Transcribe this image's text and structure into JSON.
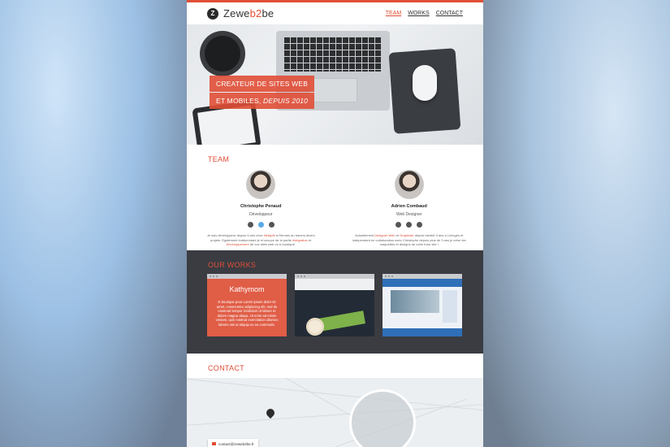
{
  "header": {
    "logo_mark": "Z",
    "logo_prefix": "Zewe",
    "logo_accent": "b2",
    "logo_suffix": "be",
    "nav": [
      "TEAM",
      "WORKS",
      "CONTACT"
    ],
    "active_nav": "TEAM"
  },
  "hero": {
    "line1": "CREATEUR DE SITES WEB",
    "line2_main": "ET MOBILES, ",
    "line2_italic": "DEPUIS 2010"
  },
  "team": {
    "title": "TEAM",
    "members": [
      {
        "name": "Christophe Penaud",
        "role": "Développeur",
        "desc_before": "Je suis développeur depuis 5 ans chez ",
        "desc_hl1": "Netapfe",
        "desc_mid": " à Rennes au travers divers projets. Egalement indépendant je m'occupe de la partie ",
        "desc_hl2": "Intégration",
        "desc_and": " et ",
        "desc_hl3": "Développement",
        "desc_after": " de vos sites web ou e-boutique."
      },
      {
        "name": "Adrien Combaud",
        "role": "Web Designer",
        "desc_before": "Actuellement ",
        "desc_hl1": "Designer Web",
        "desc_mid": " et ",
        "desc_hl2": "Graphiste",
        "desc_after": " depuis bientôt 3 ans à Limoges et indépendant en collaboration avec Christophe depuis plus de 3 ans je créer les maquettes et designs de votre futur site !"
      }
    ]
  },
  "works": {
    "title": "OUR WORKS",
    "card1_title": "Kathymom",
    "card1_text": "E-boutique pour Lorem ipsum dolor sit amet, consectetur adipiscing elit, sed do eiusmod tempor incididunt ut labore et dolore magna aliqua. Ut enim ad minim veniam, quis nostrud exercitation ullamco laboris nisi ut aliquip ex ea commodo."
  },
  "contact": {
    "title": "CONTACT",
    "email": "contact@zeweb2be.fr"
  },
  "colors": {
    "accent": "#e04e36",
    "dark_section": "#3a3c42"
  }
}
